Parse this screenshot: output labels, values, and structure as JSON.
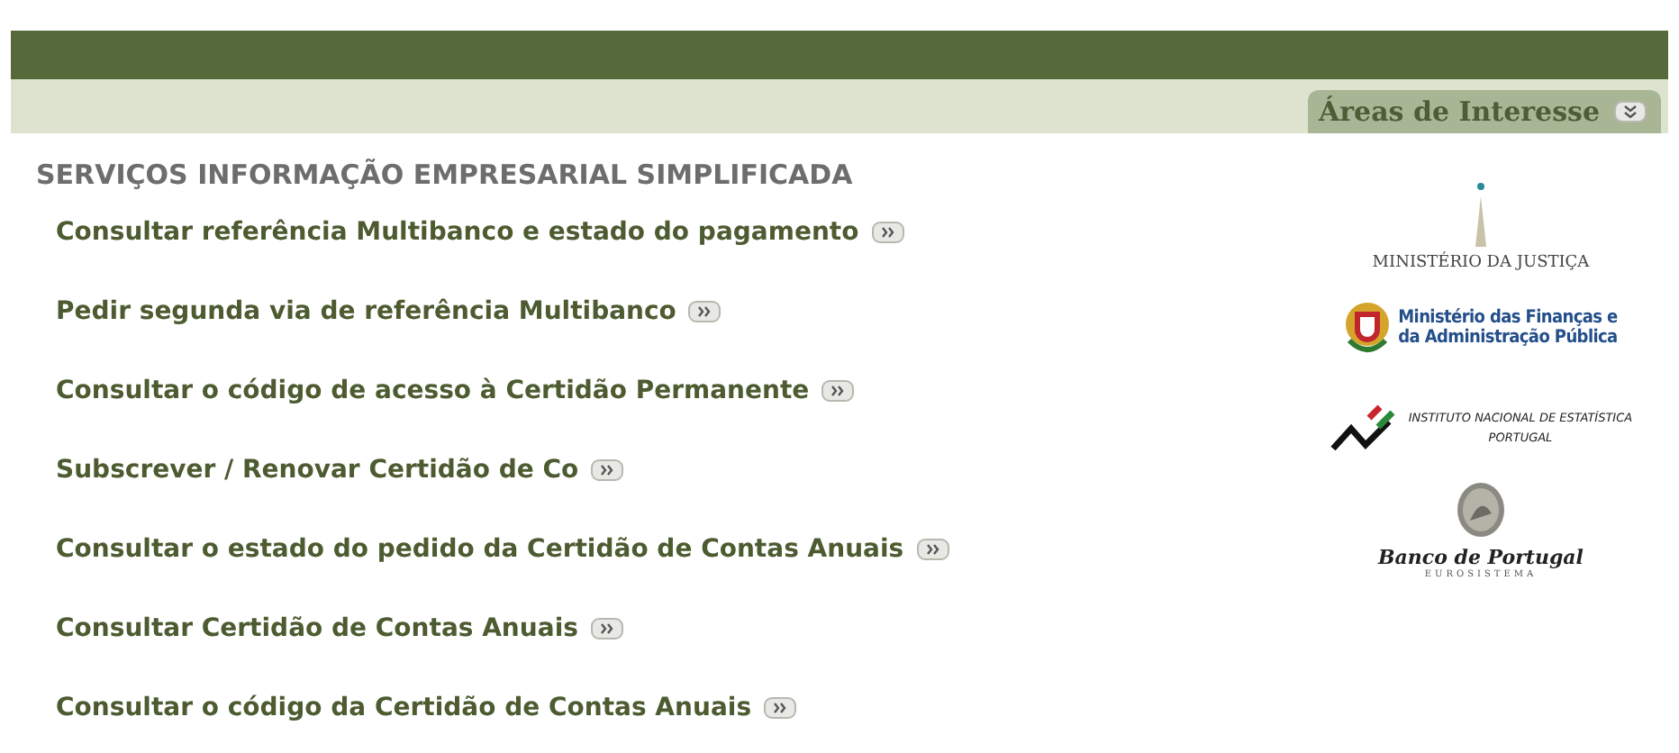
{
  "header": {
    "tab": {
      "label": "Áreas de Interesse"
    }
  },
  "section": {
    "title": "SERVIÇOS INFORMAÇÃO EMPRESARIAL SIMPLIFICADA",
    "links": [
      {
        "label": "Consultar referência Multibanco e estado do pagamento"
      },
      {
        "label": "Pedir segunda via de referência Multibanco"
      },
      {
        "label": "Consultar o código de acesso à Certidão Permanente"
      },
      {
        "label": "Subscrever / Renovar Certidão de Co"
      },
      {
        "label": "Consultar o estado do pedido da Certidão de Contas Anuais"
      },
      {
        "label": "Consultar Certidão de Contas Anuais"
      },
      {
        "label": "Consultar o código da Certidão de Contas Anuais"
      }
    ]
  },
  "sidebar": {
    "logos": [
      {
        "kind": "justica",
        "lines": [
          "MINISTÉRIO DA JUSTIÇA"
        ]
      },
      {
        "kind": "financas",
        "lines": [
          "Ministério das Finanças e",
          "da Administração Pública"
        ]
      },
      {
        "kind": "ine",
        "lines": [
          "INSTITUTO NACIONAL DE ESTATÍSTICA",
          "PORTUGAL"
        ]
      },
      {
        "kind": "bdp",
        "lines": [
          "Banco de Portugal",
          "EUROSISTEMA"
        ]
      }
    ]
  }
}
